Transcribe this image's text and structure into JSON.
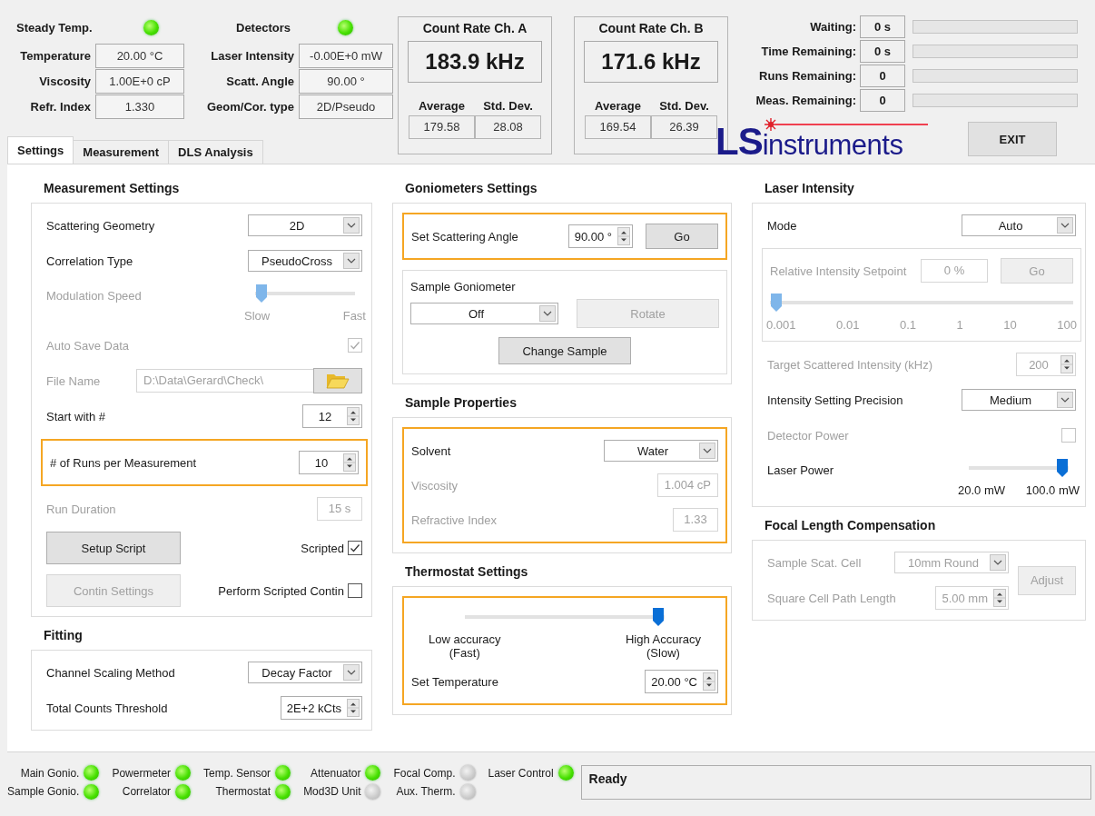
{
  "header": {
    "readout_groups": [
      {
        "indicator": {
          "label": "Steady Temp.",
          "on": true
        },
        "readouts": [
          {
            "label": "Temperature",
            "value": "20.00 °C"
          },
          {
            "label": "Viscosity",
            "value": "1.00E+0 cP"
          },
          {
            "label": "Refr. Index",
            "value": "1.330"
          }
        ]
      },
      {
        "indicator": {
          "label": "Detectors",
          "on": true
        },
        "readouts": [
          {
            "label": "Laser Intensity",
            "value": "-0.00E+0 mW"
          },
          {
            "label": "Scatt. Angle",
            "value": "90.00 °"
          },
          {
            "label": "Geom/Cor. type",
            "value": "2D/Pseudo"
          }
        ]
      }
    ],
    "count_rates": [
      {
        "title": "Count Rate Ch. A",
        "value": "183.9 kHz",
        "average_label": "Average",
        "std_label": "Std. Dev.",
        "average": "179.58",
        "std": "28.08"
      },
      {
        "title": "Count Rate Ch. B",
        "value": "171.6 kHz",
        "average_label": "Average",
        "std_label": "Std. Dev.",
        "average": "169.54",
        "std": "26.39"
      }
    ],
    "progress": [
      {
        "label": "Waiting:",
        "value": "0 s",
        "level": 0
      },
      {
        "label": "Time Remaining:",
        "value": "0 s",
        "level": 0
      },
      {
        "label": "Runs Remaining:",
        "value": "0",
        "level": 0
      },
      {
        "label": "Meas. Remaining:",
        "value": "0",
        "level": 0
      }
    ],
    "logo": {
      "initials": "LS",
      "wordmark": "instruments"
    },
    "exit_button": "EXIT"
  },
  "tabs": [
    {
      "label": "Settings",
      "selected": true
    },
    {
      "label": "Measurement",
      "selected": false
    },
    {
      "label": "DLS Analysis",
      "selected": false
    }
  ],
  "columns": [
    [
      {
        "title": "Measurement Settings",
        "rows": [
          {
            "kind": "dropdown",
            "label": "Scattering Geometry",
            "value": "2D",
            "disabled": false
          },
          {
            "kind": "dropdown",
            "label": "Correlation Type",
            "value": "PseudoCross",
            "disabled": false
          },
          {
            "kind": "slider",
            "label": "Modulation Speed",
            "level": 0,
            "ticks": [
              "Slow",
              "Fast"
            ],
            "disabled": true
          },
          {
            "kind": "checkbox",
            "label": "Auto Save Data",
            "checked": true,
            "disabled": true
          },
          {
            "kind": "file",
            "label": "File Name",
            "value": "D:\\Data\\Gerard\\Check\\",
            "disabled": true
          },
          {
            "kind": "spinner",
            "label": "Start with #",
            "value": "12",
            "disabled": false
          },
          {
            "kind": "group",
            "highlighted": true,
            "rows": [
              {
                "kind": "spinner",
                "label": "# of Runs per Measurement",
                "value": "10",
                "disabled": false
              }
            ]
          },
          {
            "kind": "field",
            "label": "Run Duration",
            "value": "15 s",
            "disabled": true
          },
          {
            "kind": "button_check",
            "button": {
              "label": "Setup Script",
              "disabled": false
            },
            "label": "Scripted",
            "checked": true,
            "disabled": false
          },
          {
            "kind": "button_check",
            "button": {
              "label": "Contin Settings",
              "disabled": true
            },
            "label": "Perform Scripted Contin",
            "checked": false,
            "disabled": false
          }
        ]
      },
      {
        "title": "Fitting",
        "rows": [
          {
            "kind": "dropdown",
            "label": "Channel Scaling Method",
            "value": "Decay Factor",
            "disabled": false
          },
          {
            "kind": "spinner",
            "label": "Total Counts Threshold",
            "value": "2E+2 kCts",
            "disabled": false
          }
        ]
      }
    ],
    [
      {
        "title": "Goniometers Settings",
        "rows": [
          {
            "kind": "group",
            "highlighted": true,
            "rows": [
              {
                "kind": "spinner_button",
                "label": "Set Scattering Angle",
                "value": "90.00 °",
                "disabled": false,
                "button": {
                  "label": "Go",
                  "disabled": false
                }
              }
            ]
          },
          {
            "kind": "group",
            "highlighted": false,
            "title": "Sample Goniometer",
            "rows": [
              {
                "kind": "dropdown_button",
                "value": "Off",
                "disabled": false,
                "button": {
                  "label": "Rotate",
                  "disabled": true
                }
              },
              {
                "kind": "button",
                "label": "Change Sample",
                "disabled": false
              }
            ]
          }
        ]
      },
      {
        "title": "Sample Properties",
        "rows": [
          {
            "kind": "group",
            "highlighted": true,
            "rows": [
              {
                "kind": "dropdown",
                "label": "Solvent",
                "value": "Water",
                "disabled": false
              },
              {
                "kind": "field",
                "label": "Viscosity",
                "value": "1.004 cP",
                "disabled": true
              },
              {
                "kind": "field",
                "label": "Refractive Index",
                "value": "1.33",
                "disabled": true
              }
            ]
          }
        ]
      },
      {
        "title": "Thermostat Settings",
        "rows": [
          {
            "kind": "group",
            "highlighted": true,
            "rows": [
              {
                "kind": "slider",
                "level": 1,
                "ticks": [
                  "Low accuracy\n(Fast)",
                  "High Accuracy\n(Slow)"
                ],
                "disabled": false
              },
              {
                "kind": "spinner",
                "label": "Set Temperature",
                "value": "20.00 °C",
                "disabled": false
              }
            ]
          }
        ]
      }
    ],
    [
      {
        "title": "Laser Intensity",
        "rows": [
          {
            "kind": "dropdown",
            "label": "Mode",
            "value": "Auto",
            "disabled": false
          },
          {
            "kind": "group",
            "highlighted": false,
            "rows": [
              {
                "kind": "field_button",
                "label": "Relative Intensity Setpoint",
                "value": "0 %",
                "disabled": true,
                "button": {
                  "label": "Go",
                  "disabled": true
                }
              },
              {
                "kind": "slider",
                "level": 0,
                "ticks": [
                  "0.001",
                  "0.01",
                  "0.1",
                  "1",
                  "10",
                  "100"
                ],
                "disabled": true
              }
            ]
          },
          {
            "kind": "spinner",
            "label": "Target Scattered Intensity (kHz)",
            "value": "200",
            "disabled": true
          },
          {
            "kind": "dropdown",
            "label": "Intensity Setting Precision",
            "value": "Medium",
            "disabled": false
          },
          {
            "kind": "checkbox",
            "label": "Detector Power",
            "checked": false,
            "disabled": true
          },
          {
            "kind": "slider",
            "label": "Laser Power",
            "level": 1,
            "ticks": [
              "20.0 mW",
              "100.0 mW"
            ],
            "disabled": false
          }
        ]
      },
      {
        "title": "Focal Length Compensation",
        "side_button": {
          "label": "Adjust",
          "disabled": true
        },
        "rows": [
          {
            "kind": "dropdown",
            "label": "Sample Scat. Cell",
            "value": "10mm Round",
            "disabled": true
          },
          {
            "kind": "spinner",
            "label": "Square Cell Path Length",
            "value": "5.00 mm",
            "disabled": true
          }
        ]
      }
    ]
  ],
  "status_lights": [
    {
      "label": "Main Gonio.",
      "on": true
    },
    {
      "label": "Powermeter",
      "on": true
    },
    {
      "label": "Temp. Sensor",
      "on": true
    },
    {
      "label": "Attenuator",
      "on": true
    },
    {
      "label": "Focal Comp.",
      "on": false
    },
    {
      "label": "Laser Control",
      "on": true
    },
    {
      "label": "Sample Gonio.",
      "on": true
    },
    {
      "label": "Correlator",
      "on": true
    },
    {
      "label": "Thermostat",
      "on": true
    },
    {
      "label": "Mod3D Unit",
      "on": false
    },
    {
      "label": "Aux. Therm.",
      "on": false
    }
  ],
  "status_message": "Ready"
}
